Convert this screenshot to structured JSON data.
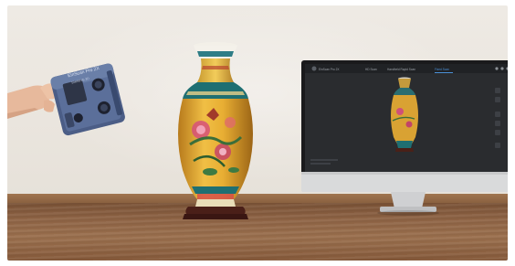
{
  "scene": {
    "scanner": {
      "brand_text": "EinScan Pro 2X",
      "sub_text": "SHINING 3D"
    },
    "monitor": {
      "toolbar_items": [
        "EinScan Pro 2X",
        "HD Scan",
        "Handheld Rapid Scan",
        "Fixed Scan"
      ]
    }
  },
  "colors": {
    "wall": "#ece7e0",
    "table": "#8f6445",
    "vase_body": "#e2a72e",
    "vase_band": "#1f6f72",
    "monitor_bezel": "#1a1a1c",
    "monitor_frame": "#d9dadb",
    "screen_bg": "#2a2c2f",
    "scanner_body": "#4b5d86"
  }
}
